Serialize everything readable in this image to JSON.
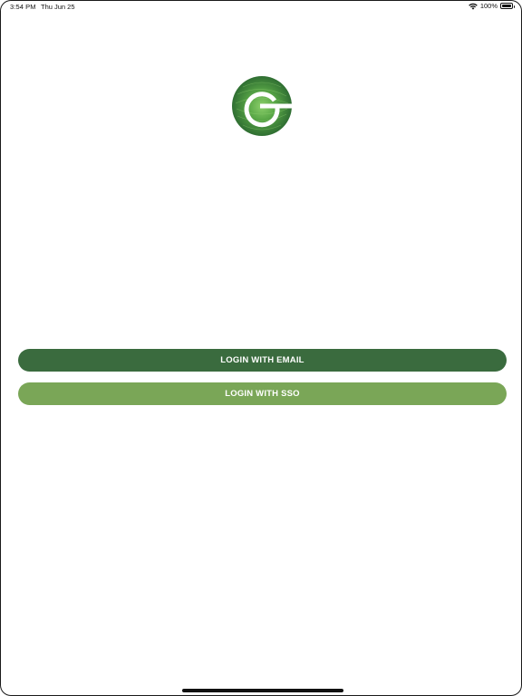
{
  "status_bar": {
    "time": "3:54 PM",
    "date": "Thu Jun 25",
    "battery_percent": "100%",
    "battery_level": 1.0,
    "icons": [
      "wifi-icon",
      "battery-icon"
    ]
  },
  "logo": {
    "icon": "company-logo-g",
    "colors": {
      "outer": "#2f6e32",
      "inner": "#5aa847",
      "highlight": "#8ccf6b"
    }
  },
  "buttons": {
    "login_email": {
      "label": "LOGIN WITH EMAIL",
      "color": "#3a6b3e"
    },
    "login_sso": {
      "label": "LOGIN WITH SSO",
      "color": "#7aa657"
    }
  },
  "colors": {
    "background": "#ffffff",
    "text_on_button": "#ffffff"
  }
}
